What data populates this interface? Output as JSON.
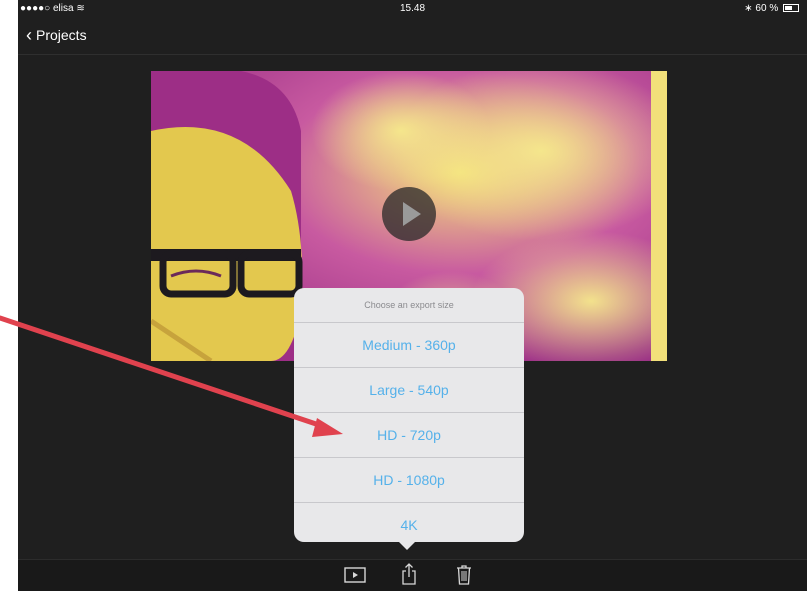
{
  "status_bar": {
    "carrier": "●●●●○ elisa",
    "time": "15.48",
    "battery": "60 %"
  },
  "nav": {
    "back_label": "Projects"
  },
  "export_menu": {
    "title": "Choose an export size",
    "options": [
      "Medium - 360p",
      "Large - 540p",
      "HD - 720p",
      "HD - 1080p",
      "4K"
    ]
  },
  "toolbar": {
    "icons": [
      "play-icon",
      "share-icon",
      "trash-icon"
    ]
  },
  "colors": {
    "accent": "#55b1ea",
    "background": "#1f1f1f",
    "popover": "#e8e8ea",
    "annotation_arrow": "#e0424e"
  }
}
